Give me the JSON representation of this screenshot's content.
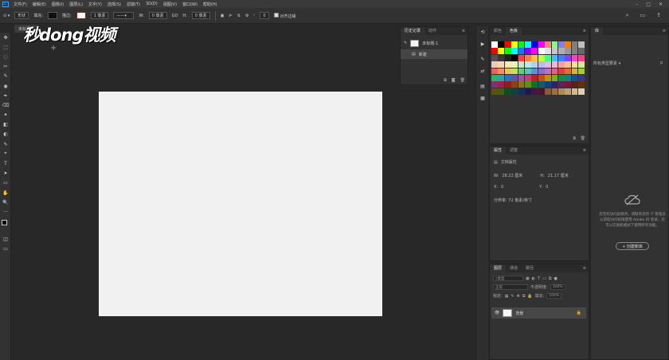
{
  "menubar": {
    "logo": "Ps",
    "items": [
      "文件(F)",
      "编辑(E)",
      "图像(I)",
      "图层(L)",
      "文字(Y)",
      "选择(S)",
      "滤镜(T)",
      "3D(D)",
      "视图(V)",
      "窗口(W)",
      "帮助(H)"
    ]
  },
  "options": {
    "shape_label": "形状",
    "fill_label": "填充:",
    "stroke_label": "描边:",
    "stroke_width": "1 像素",
    "w_label": "W:",
    "w_value": "0 像素",
    "link": "GO",
    "h_label": "H:",
    "h_value": "0 像素",
    "corner_value": "0",
    "align_edges_label": "对齐边缘"
  },
  "document": {
    "tab": "未标题-1"
  },
  "watermark": "秒dong视频",
  "tools": [
    "✥",
    "⬚",
    "◌",
    "✂",
    "✎",
    "◉",
    "✒",
    "⌫",
    "✦",
    "◧",
    "◐",
    "✎",
    "⌖",
    "T",
    "➤",
    "▭",
    "✋",
    "🔍",
    "···"
  ],
  "history": {
    "tabs": [
      "历史记录",
      "动作"
    ],
    "doc_name": "未标题-1",
    "state": "新建"
  },
  "swatches": {
    "tabs": [
      "颜色",
      "色板"
    ],
    "colors": [
      "#ffffff",
      "#000000",
      "#ff0000",
      "#ffff00",
      "#00ff00",
      "#00ffff",
      "#0000ff",
      "#ff00ff",
      "#ff8080",
      "#80ff80",
      "#8080ff",
      "#ff8000",
      "#808080",
      "#c0c0c0",
      "#ff0000",
      "#ffff00",
      "#00ff00",
      "#00ffff",
      "#0080ff",
      "#8000ff",
      "#ff00ff",
      "#ffffff",
      "#e0e0e0",
      "#c8c8c8",
      "#b0b0b0",
      "#989898",
      "#808080",
      "#686868",
      "#505050",
      "#383838",
      "#202020",
      "#000000",
      "#ff4040",
      "#ff8040",
      "#ffc040",
      "#c0ff40",
      "#40ff80",
      "#40c0ff",
      "#4080ff",
      "#8040ff",
      "#ff40c0",
      "#ff4080",
      "#f5c6b8",
      "#f7d5b0",
      "#f9e8b0",
      "#e8f5b0",
      "#c0ecc0",
      "#b8e8e8",
      "#b0d0f0",
      "#c0b8e8",
      "#e0b8e8",
      "#f0b8d0",
      "#f8a0a0",
      "#f8c090",
      "#f8e090",
      "#d0f090",
      "#f06060",
      "#f09060",
      "#f0c060",
      "#c0e060",
      "#60d080",
      "#60c0c0",
      "#6090d8",
      "#8070d0",
      "#c070c0",
      "#e06090",
      "#e04040",
      "#e07030",
      "#e0b030",
      "#a0d030",
      "#30b060",
      "#30a0a0",
      "#3070c0",
      "#6050b0",
      "#a050a0",
      "#c04070",
      "#c02020",
      "#c05010",
      "#c09010",
      "#80b010",
      "#109040",
      "#108080",
      "#1050a0",
      "#403090",
      "#803080",
      "#a02050",
      "#902010",
      "#904010",
      "#907010",
      "#609010",
      "#107030",
      "#106060",
      "#104080",
      "#302070",
      "#602060",
      "#801040",
      "#602010",
      "#603010",
      "#605010",
      "#406010",
      "#105020",
      "#104040",
      "#103060",
      "#201850",
      "#401840",
      "#501030",
      "#8a5a3a",
      "#a0703a",
      "#b08a50",
      "#c0a070",
      "#d0b890",
      "#e0d0b0"
    ]
  },
  "properties": {
    "tabs": [
      "属性",
      "调整"
    ],
    "title": "文档属性",
    "w_label": "W:",
    "w_value": "28.22 厘米",
    "h_label": "H:",
    "h_value": "21.17 厘米",
    "x_label": "X:",
    "x_value": "0",
    "y_label": "Y:",
    "y_value": "0",
    "resolution": "分辨率: 72 像素/英寸"
  },
  "layers": {
    "tabs": [
      "图层",
      "通道",
      "路径"
    ],
    "filter": "类型",
    "blend": "正常",
    "opacity_label": "不透明度:",
    "opacity": "100%",
    "lock_label": "锁定:",
    "fill_label": "填充:",
    "fill": "100%",
    "layer_name": "背景"
  },
  "library": {
    "tab": "库",
    "select": "所有类型要素",
    "message": "您无权访问此服务。请联系您的 IT 管理员以获取访问权限使用 Adobe ID 登录，您可以在脱机模式下使用所有功能。",
    "create_button": "+ 创建新库"
  }
}
